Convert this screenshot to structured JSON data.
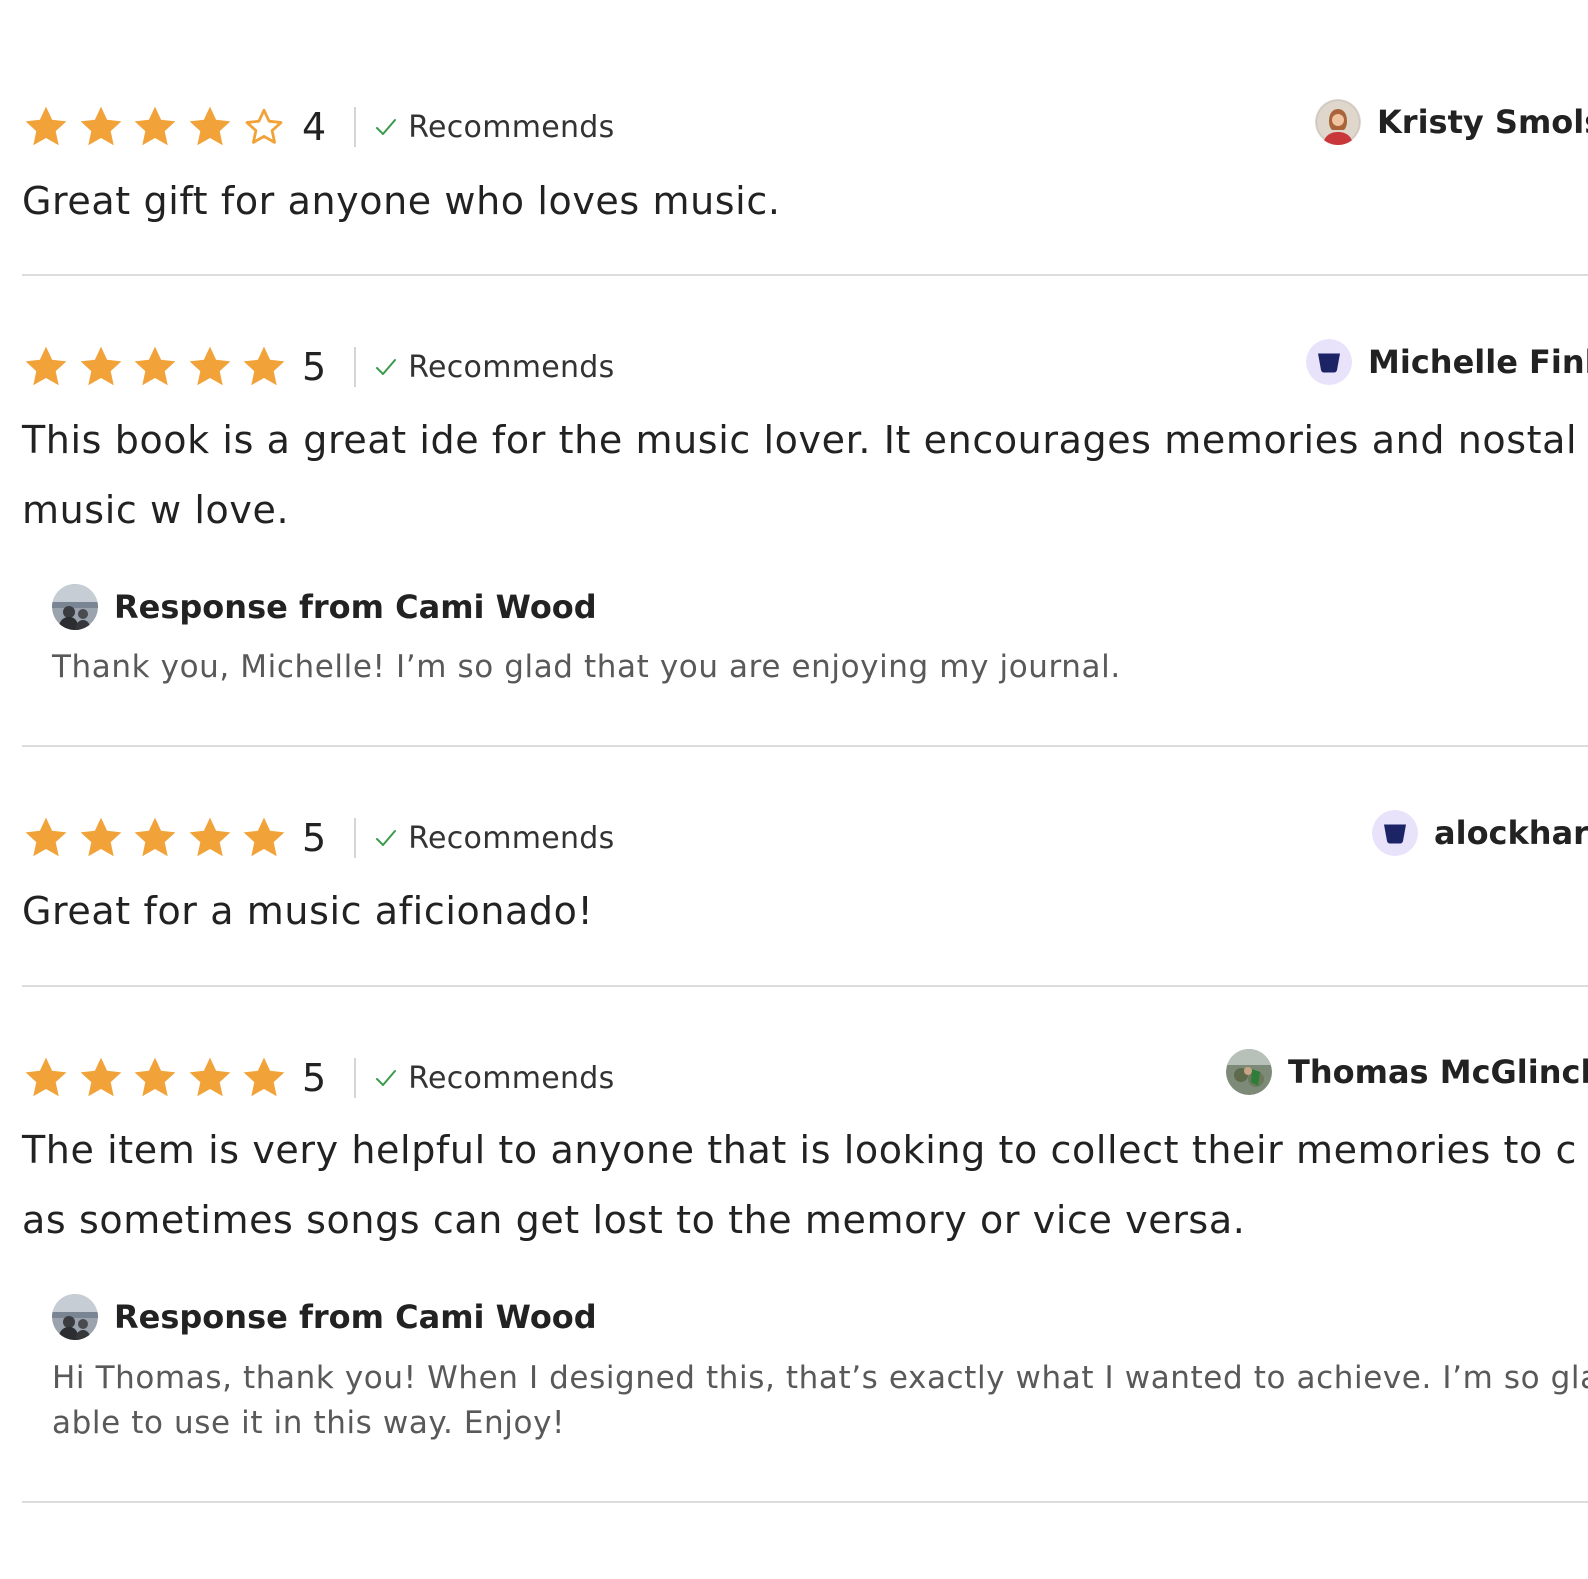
{
  "colors": {
    "star": "#f1a33a",
    "check": "#3a9a4a",
    "badge_bg": "#e9e2fb",
    "badge_fg": "#1c2466"
  },
  "reviews": [
    {
      "rating": 4,
      "rating_label": "4",
      "recommends_label": "Recommends",
      "reviewer": {
        "name": "Kristy Smols",
        "avatar": "photo-avatar"
      },
      "text_lines": [
        "Great gift for anyone who loves music."
      ]
    },
    {
      "rating": 5,
      "rating_label": "5",
      "recommends_label": "Recommends",
      "reviewer": {
        "name": "Michelle Finl",
        "avatar": "default-shield-avatar"
      },
      "text_lines": [
        "This book is a great ide for the music lover. It encourages memories and nostal",
        "music w love."
      ],
      "response": {
        "title": "Response from Cami Wood",
        "text_lines": [
          "Thank you, Michelle! I’m so glad that you are enjoying my journal."
        ]
      }
    },
    {
      "rating": 5,
      "rating_label": "5",
      "recommends_label": "Recommends",
      "reviewer": {
        "name": "alockhar",
        "avatar": "default-shield-avatar"
      },
      "text_lines": [
        "Great for a music aficionado!"
      ]
    },
    {
      "rating": 5,
      "rating_label": "5",
      "recommends_label": "Recommends",
      "reviewer": {
        "name": "Thomas McGlinch",
        "avatar": "photo-avatar"
      },
      "text_lines": [
        "The item is very helpful to anyone that is looking to collect their memories to c",
        "as sometimes songs can get lost to the memory or vice versa."
      ],
      "response": {
        "title": "Response from Cami Wood",
        "text_lines": [
          "Hi Thomas, thank you! When I designed this, that’s exactly what I wanted to achieve. I’m so glad",
          "able to use it in this way. Enjoy!"
        ]
      }
    }
  ]
}
